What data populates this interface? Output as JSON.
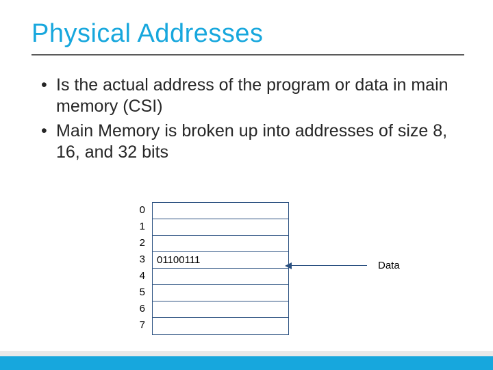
{
  "title": "Physical Addresses",
  "bullets": [
    "Is the actual address of the program or data in main memory (CSI)",
    "Main Memory is broken up into addresses of size 8, 16, and 32 bits"
  ],
  "memory": {
    "addresses": [
      "0",
      "1",
      "2",
      "3",
      "4",
      "5",
      "6",
      "7"
    ],
    "cells": [
      "",
      "",
      "",
      "01100111",
      "",
      "",
      "",
      ""
    ],
    "label": "Data"
  }
}
